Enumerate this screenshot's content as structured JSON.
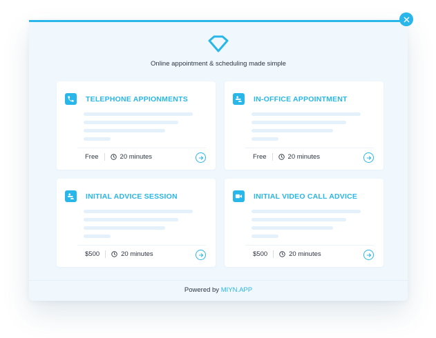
{
  "modal": {
    "tagline": "Online appointment &  scheduling made simple",
    "powered_by_prefix": "Powered by",
    "powered_by_brand": "MIYN.APP",
    "accent_color": "#29b6e8"
  },
  "cards": [
    {
      "title": "TELEPHONE APPIONMENTS",
      "icon": "phone-icon",
      "price": "Free",
      "duration": "20 minutes"
    },
    {
      "title": "IN-OFFICE APPOINTMENT",
      "icon": "people-icon",
      "price": "Free",
      "duration": "20 minutes"
    },
    {
      "title": "INITIAL ADVICE SESSION",
      "icon": "people-icon",
      "price": "$500",
      "duration": "20 minutes"
    },
    {
      "title": "INITIAL VIDEO CALL ADVICE",
      "icon": "video-camera-icon",
      "price": "$500",
      "duration": "20 minutes"
    }
  ]
}
